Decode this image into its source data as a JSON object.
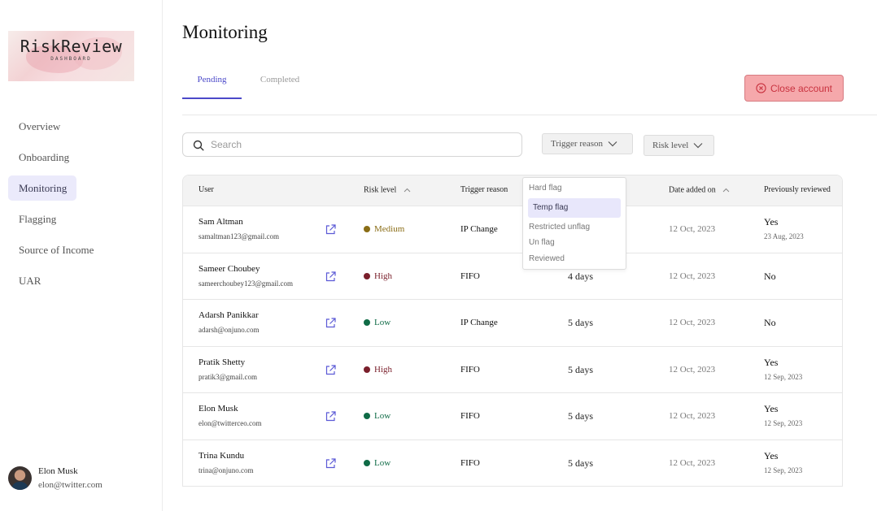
{
  "brand": {
    "name": "RiskReview",
    "tagline": "DASHBOARD"
  },
  "sidebar": {
    "items": [
      {
        "label": "Overview"
      },
      {
        "label": "Onboarding"
      },
      {
        "label": "Monitoring",
        "active": true
      },
      {
        "label": "Flagging"
      },
      {
        "label": "Source of Income"
      },
      {
        "label": "UAR"
      }
    ]
  },
  "user": {
    "name": "Elon Musk",
    "email": "elon@twitter.com"
  },
  "page": {
    "title": "Monitoring"
  },
  "tabs": [
    {
      "label": "Pending",
      "active": true
    },
    {
      "label": "Completed"
    }
  ],
  "actions": {
    "close_account": "Close account"
  },
  "search": {
    "placeholder": "Search",
    "value": ""
  },
  "filters": {
    "trigger_reason": "Trigger reason",
    "risk_level": "Risk level"
  },
  "table": {
    "headers": {
      "user": "User",
      "risk_level": "Risk level",
      "trigger_reason": "Trigger reason",
      "date_added": "Date added on",
      "previously_reviewed": "Previously reviewed"
    },
    "rows": [
      {
        "name": "Sam Altman",
        "email": "samaltman123@gmail.com",
        "risk": "Medium",
        "risk_color": "#8a6d16",
        "trigger": "IP Change",
        "ago": "",
        "date": "12 Oct, 2023",
        "reviewed": "Yes",
        "reviewed_date": "23 Aug, 2023"
      },
      {
        "name": "Sameer Choubey",
        "email": "sameerchoubey123@gmail.com",
        "risk": "High",
        "risk_color": "#7a1f2b",
        "trigger": "FIFO",
        "ago": "4 days",
        "date": "12 Oct, 2023",
        "reviewed": "No",
        "reviewed_date": ""
      },
      {
        "name": "Adarsh Panikkar",
        "email": "adarsh@onjuno.com",
        "risk": "Low",
        "risk_color": "#0f6b46",
        "trigger": "IP Change",
        "ago": "5 days",
        "date": "12 Oct, 2023",
        "reviewed": "No",
        "reviewed_date": ""
      },
      {
        "name": "Pratik Shetty",
        "email": "pratik3@gmail.com",
        "risk": "High",
        "risk_color": "#7a1f2b",
        "trigger": "FIFO",
        "ago": "5 days",
        "date": "12 Oct, 2023",
        "reviewed": "Yes",
        "reviewed_date": "12 Sep, 2023"
      },
      {
        "name": "Elon Musk",
        "email": "elon@twitterceo.com",
        "risk": "Low",
        "risk_color": "#0f6b46",
        "trigger": "FIFO",
        "ago": "5 days",
        "date": "12 Oct, 2023",
        "reviewed": "Yes",
        "reviewed_date": "12 Sep, 2023"
      },
      {
        "name": "Trina Kundu",
        "email": "trina@onjuno.com",
        "risk": "Low",
        "risk_color": "#0f6b46",
        "trigger": "FIFO",
        "ago": "5 days",
        "date": "12 Oct, 2023",
        "reviewed": "Yes",
        "reviewed_date": "12 Sep, 2023"
      }
    ]
  },
  "dropdown": {
    "options": [
      "Hard flag",
      "Temp flag",
      "Restricted unflag",
      "Un flag",
      "Reviewed"
    ],
    "highlighted": "Temp flag"
  },
  "colors": {
    "accent": "#4b49c9",
    "danger_bg": "#f5a8ab",
    "danger_text": "#c9323f",
    "nav_active_bg": "#ebeafb",
    "link_icon": "#5b59d6"
  },
  "icons": [
    "search-icon",
    "chevron-down-icon",
    "sort-icon",
    "external-link-icon",
    "close-circle-icon"
  ]
}
